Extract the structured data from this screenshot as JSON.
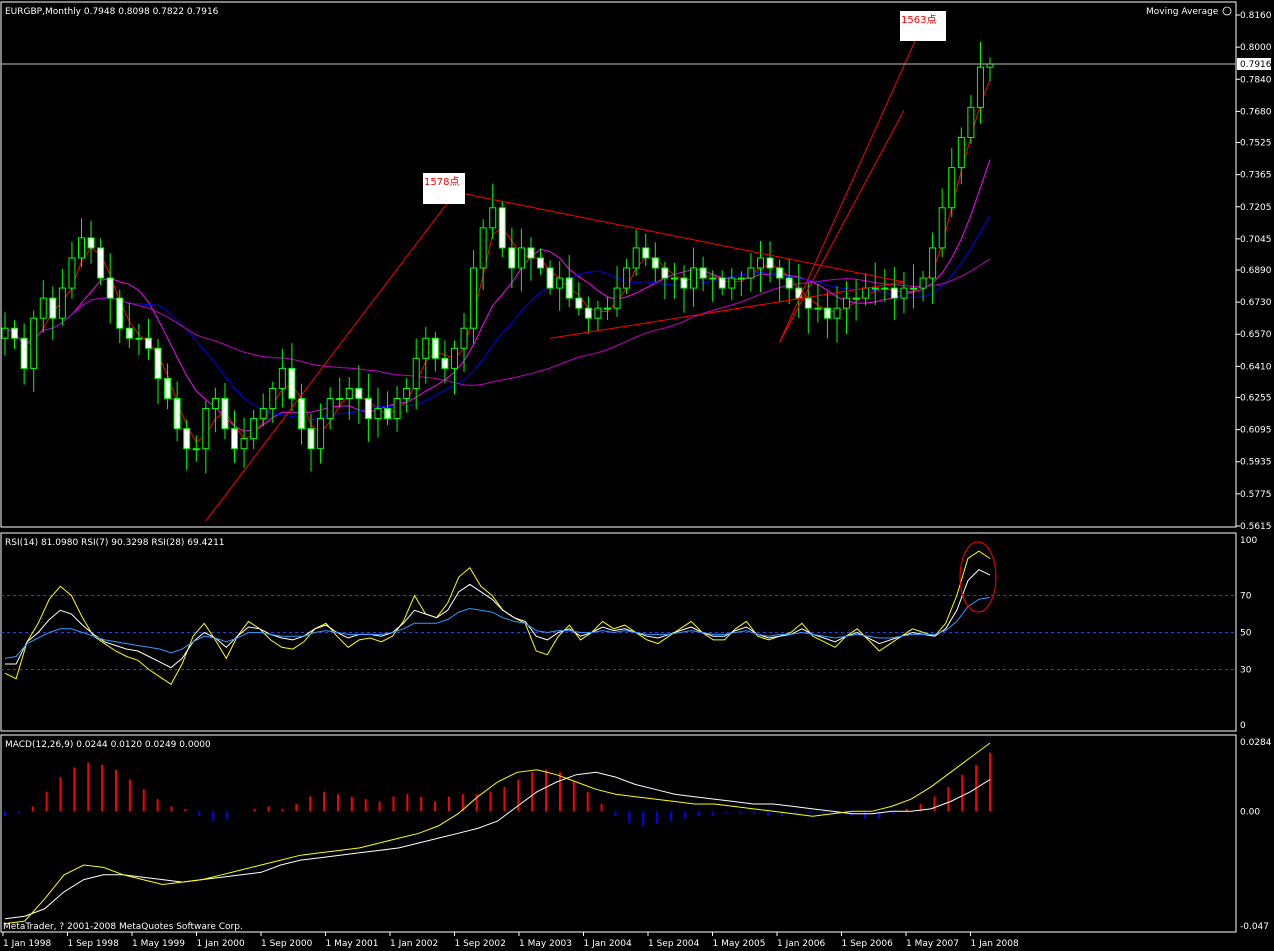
{
  "chart_header": {
    "title": "EURGBP,Monthly  0.7948 0.8098 0.7822 0.7916",
    "indicator": "Moving Average",
    "price_tag": "0.7916",
    "copyright": "MetaTrader, ? 2001-2008 MetaQuotes Software Corp."
  },
  "annotations": {
    "left_move": "1578点",
    "right_move": "1563点"
  },
  "rsi_header": "RSI(14) 81.0980  RSI(7) 90.3298  RSI(28) 69.4211",
  "macd_header": "MACD(12,26,9) 0.0244 0.0120 0.0249 0.0000",
  "colors": {
    "background": "#000000",
    "bull": "#00ff00",
    "bear_fill": "#ffffff",
    "grid": "#ffffff",
    "ma_fast": "#ff0000",
    "ma_mid": "#ff00ff",
    "ma_slow": "#0000ff",
    "ma_long": "#c000c0",
    "rsi7": "#ffff00",
    "rsi14": "#ffffff",
    "rsi28": "#3399ff",
    "macd_pos": "#ff0000",
    "macd_neg": "#0000ff",
    "macd_line": "#ffffff",
    "signal_line": "#ffff00",
    "trendline": "#ff0000"
  },
  "chart_data": [
    {
      "type": "candlestick",
      "symbol": "EURGBP",
      "timeframe": "Monthly",
      "last_bar": {
        "open": 0.7948,
        "high": 0.8098,
        "low": 0.7822,
        "close": 0.7916
      },
      "y_ticks": [
        "0.8160",
        "0.8000",
        "0.7840",
        "0.7680",
        "0.7525",
        "0.7365",
        "0.7205",
        "0.7045",
        "0.6890",
        "0.6730",
        "0.6570",
        "0.6410",
        "0.6255",
        "0.6095",
        "0.5935",
        "0.5775",
        "0.5615"
      ],
      "ylim": [
        0.5615,
        0.816
      ],
      "x_ticks": [
        "1 Jan 1998",
        "1 Sep 1998",
        "1 May 1999",
        "1 Jan 2000",
        "1 Sep 2000",
        "1 May 2001",
        "1 Jan 2002",
        "1 Sep 2002",
        "1 May 2003",
        "1 Jan 2004",
        "1 Sep 2004",
        "1 May 2005",
        "1 Jan 2006",
        "1 Sep 2006",
        "1 May 2007",
        "1 Jan 2008"
      ],
      "close_path": [
        0.66,
        0.655,
        0.64,
        0.665,
        0.675,
        0.665,
        0.68,
        0.695,
        0.705,
        0.7,
        0.685,
        0.675,
        0.66,
        0.655,
        0.655,
        0.65,
        0.635,
        0.625,
        0.61,
        0.6,
        0.6,
        0.62,
        0.625,
        0.61,
        0.6,
        0.605,
        0.615,
        0.62,
        0.63,
        0.64,
        0.625,
        0.61,
        0.6,
        0.615,
        0.625,
        0.625,
        0.63,
        0.625,
        0.615,
        0.62,
        0.615,
        0.625,
        0.63,
        0.645,
        0.655,
        0.645,
        0.64,
        0.65,
        0.66,
        0.69,
        0.71,
        0.72,
        0.7,
        0.69,
        0.7,
        0.695,
        0.69,
        0.68,
        0.685,
        0.675,
        0.67,
        0.665,
        0.67,
        0.67,
        0.68,
        0.69,
        0.7,
        0.695,
        0.69,
        0.685,
        0.685,
        0.68,
        0.69,
        0.685,
        0.685,
        0.68,
        0.685,
        0.685,
        0.69,
        0.695,
        0.69,
        0.685,
        0.68,
        0.675,
        0.67,
        0.67,
        0.665,
        0.67,
        0.675,
        0.675,
        0.68,
        0.68,
        0.68,
        0.675,
        0.68,
        0.68,
        0.685,
        0.7,
        0.72,
        0.74,
        0.755,
        0.77,
        0.79,
        0.7916
      ]
    },
    {
      "type": "line",
      "name": "RSI",
      "levels": [
        70,
        50,
        30
      ],
      "y_ticks": [
        "100",
        "70",
        "50",
        "30",
        "0"
      ],
      "ylim": [
        0,
        100
      ],
      "series": [
        {
          "name": "RSI(7)",
          "values": [
            28,
            25,
            45,
            55,
            68,
            75,
            70,
            58,
            48,
            44,
            40,
            37,
            35,
            30,
            26,
            22,
            33,
            48,
            55,
            46,
            36,
            48,
            56,
            52,
            46,
            42,
            41,
            45,
            52,
            55,
            48,
            42,
            46,
            47,
            45,
            48,
            56,
            70,
            60,
            58,
            66,
            80,
            85,
            75,
            70,
            62,
            58,
            55,
            40,
            38,
            48,
            54,
            46,
            50,
            56,
            52,
            54,
            50,
            46,
            44,
            48,
            52,
            56,
            50,
            46,
            46,
            52,
            56,
            48,
            46,
            48,
            50,
            55,
            48,
            45,
            42,
            48,
            52,
            46,
            40,
            44,
            48,
            52,
            50,
            48,
            55,
            70,
            90,
            94,
            90
          ]
        },
        {
          "name": "RSI(14)",
          "values": [
            33,
            33,
            45,
            50,
            57,
            62,
            60,
            54,
            49,
            45,
            43,
            41,
            40,
            37,
            34,
            31,
            36,
            45,
            50,
            47,
            42,
            48,
            53,
            52,
            49,
            47,
            46,
            48,
            52,
            54,
            50,
            47,
            49,
            49,
            48,
            50,
            55,
            62,
            60,
            58,
            62,
            72,
            76,
            72,
            68,
            62,
            58,
            56,
            48,
            46,
            50,
            52,
            48,
            50,
            53,
            51,
            52,
            50,
            48,
            47,
            49,
            51,
            53,
            50,
            48,
            48,
            51,
            53,
            49,
            47,
            48,
            49,
            52,
            49,
            47,
            45,
            48,
            50,
            47,
            44,
            46,
            48,
            50,
            49,
            48,
            52,
            62,
            78,
            84,
            81
          ]
        },
        {
          "name": "RSI(28)",
          "values": [
            36,
            37,
            44,
            47,
            50,
            52,
            52,
            50,
            48,
            46,
            45,
            44,
            43,
            42,
            41,
            39,
            41,
            45,
            48,
            47,
            45,
            47,
            50,
            50,
            49,
            48,
            48,
            48,
            50,
            51,
            50,
            49,
            49,
            49,
            49,
            50,
            52,
            55,
            55,
            55,
            57,
            61,
            63,
            62,
            61,
            58,
            56,
            55,
            51,
            50,
            51,
            51,
            50,
            50,
            51,
            50,
            51,
            50,
            49,
            49,
            49,
            50,
            51,
            50,
            49,
            49,
            50,
            51,
            49,
            48,
            49,
            49,
            50,
            49,
            48,
            47,
            48,
            49,
            48,
            47,
            47,
            48,
            49,
            49,
            49,
            51,
            56,
            64,
            68,
            69
          ]
        }
      ]
    },
    {
      "type": "bar+line",
      "name": "MACD",
      "y_ticks": [
        "0.0284",
        "0.00",
        "-0.047"
      ],
      "ylim": [
        -0.047,
        0.0284
      ],
      "histogram": [
        -0.002,
        -0.001,
        0.002,
        0.008,
        0.014,
        0.018,
        0.02,
        0.019,
        0.017,
        0.013,
        0.009,
        0.005,
        0.002,
        0.001,
        -0.002,
        -0.004,
        -0.003,
        0,
        0.001,
        0.002,
        0.001,
        0.003,
        0.006,
        0.008,
        0.007,
        0.006,
        0.005,
        0.004,
        0.006,
        0.007,
        0.006,
        0.004,
        0.006,
        0.007,
        0.007,
        0.008,
        0.01,
        0.013,
        0.016,
        0.017,
        0.016,
        0.012,
        0.008,
        0.003,
        -0.002,
        -0.005,
        -0.006,
        -0.005,
        -0.004,
        -0.003,
        -0.002,
        -0.002,
        -0.001,
        -0.001,
        -0.001,
        -0.002,
        -0.002,
        -0.001,
        -0.001,
        -0.001,
        -0.001,
        -0.002,
        -0.003,
        -0.003,
        -0.001,
        0.001,
        0.003,
        0.006,
        0.01,
        0.015,
        0.019,
        0.024
      ],
      "macd_line": [
        -0.044,
        -0.043,
        -0.04,
        -0.033,
        -0.028,
        -0.026,
        -0.026,
        -0.027,
        -0.028,
        -0.029,
        -0.028,
        -0.027,
        -0.026,
        -0.025,
        -0.022,
        -0.02,
        -0.019,
        -0.018,
        -0.017,
        -0.016,
        -0.015,
        -0.013,
        -0.011,
        -0.009,
        -0.007,
        -0.004,
        0.002,
        0.008,
        0.012,
        0.015,
        0.016,
        0.014,
        0.011,
        0.009,
        0.007,
        0.006,
        0.005,
        0.004,
        0.003,
        0.003,
        0.002,
        0.001,
        0,
        -0.001,
        -0.001,
        0,
        0,
        0.001,
        0.004,
        0.008,
        0.013
      ],
      "signal_line": [
        -0.046,
        -0.045,
        -0.036,
        -0.026,
        -0.022,
        -0.023,
        -0.026,
        -0.028,
        -0.03,
        -0.029,
        -0.028,
        -0.026,
        -0.024,
        -0.022,
        -0.02,
        -0.018,
        -0.017,
        -0.016,
        -0.015,
        -0.013,
        -0.011,
        -0.009,
        -0.006,
        -0.001,
        0.006,
        0.012,
        0.016,
        0.017,
        0.015,
        0.012,
        0.009,
        0.007,
        0.006,
        0.005,
        0.004,
        0.003,
        0.003,
        0.002,
        0.001,
        0,
        -0.001,
        -0.002,
        -0.001,
        0,
        0,
        0.002,
        0.005,
        0.01,
        0.016,
        0.022,
        0.028
      ]
    }
  ]
}
